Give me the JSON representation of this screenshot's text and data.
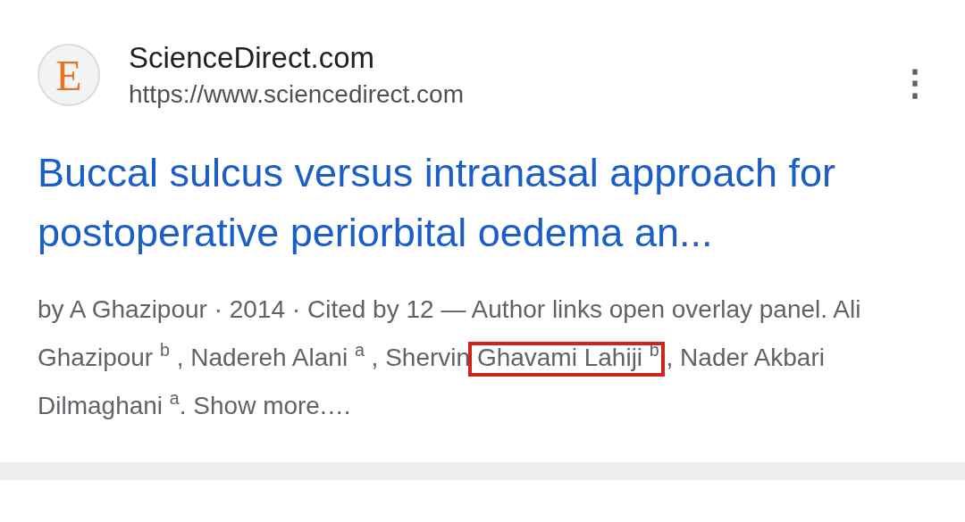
{
  "result": {
    "site_name": "ScienceDirect.com",
    "url": "https://www.sciencedirect.com",
    "favicon_letter": "E",
    "menu_glyph": "⋮",
    "title": "Buccal sulcus versus intranasal approach for postoperative periorbital oedema an...",
    "snippet_before": "by A Ghazipour · 2014 · Cited by 12 — Author links open overlay panel. Ali Ghazipour $^{b}$ , Nadereh Alani $^{a}$ , Shervin ",
    "snippet_highlighted": "Ghavami Lahiji $^{b}$",
    "snippet_after": " , Nader Akbari Dilmaghani $^{a}$. Show more.…"
  },
  "annotation": {
    "kind": "box",
    "color": "#d0231c"
  }
}
